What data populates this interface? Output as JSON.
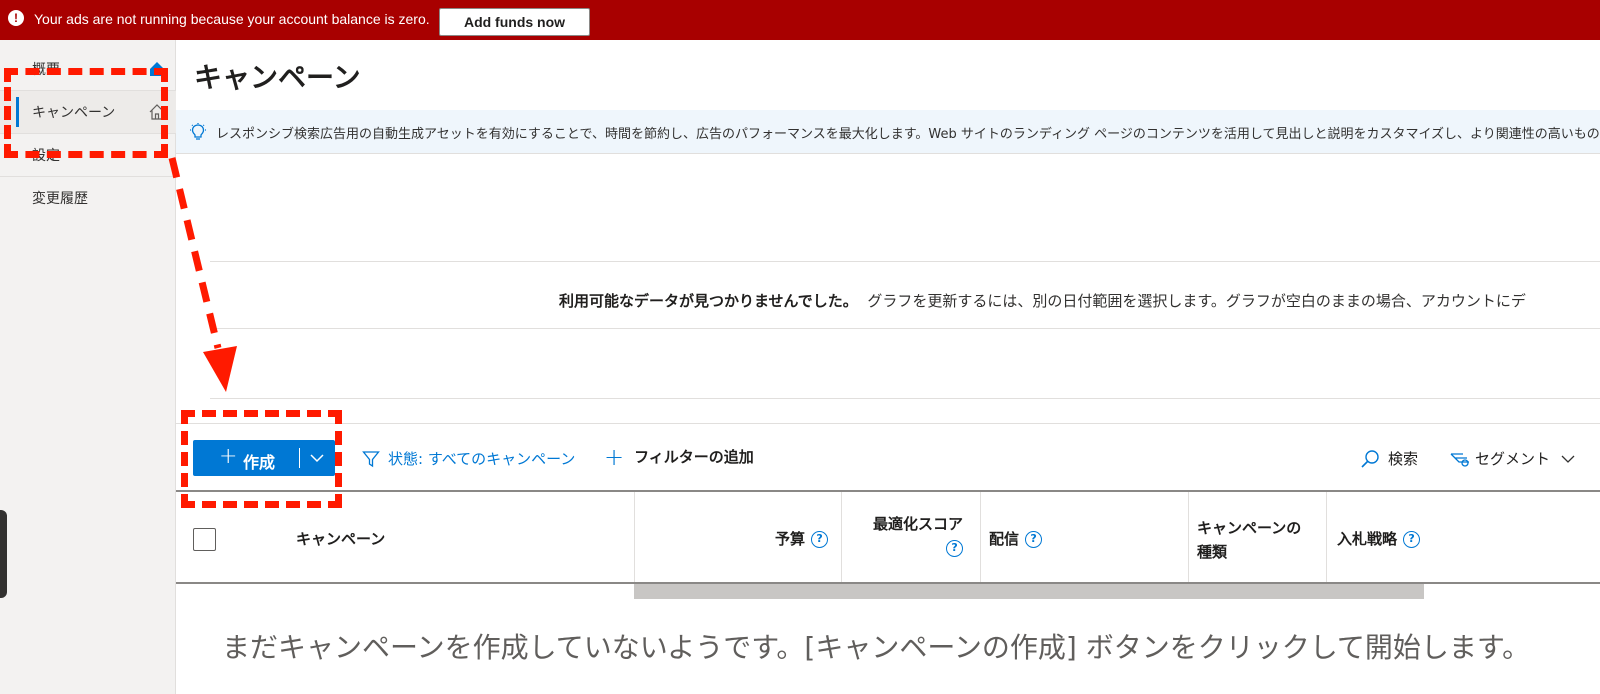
{
  "banner": {
    "message": "Your ads are not running because your account balance is zero.",
    "button_label": "Add funds now",
    "icon": "alert-icon",
    "color": "#a80000"
  },
  "sidebar": {
    "items": [
      {
        "label": "概要",
        "icon": "home-icon"
      },
      {
        "label": "キャンペーン",
        "icon": "home-icon",
        "active": true
      },
      {
        "label": "設定"
      },
      {
        "label": "変更履歴"
      }
    ]
  },
  "page": {
    "title": "キャンペーン"
  },
  "tip": {
    "icon": "lightbulb-icon",
    "text": "レスポンシブ検索広告用の自動生成アセットを有効にすることで、時間を節約し、広告のパフォーマンスを最大化します。Web サイトのランディング ページのコンテンツを活用して見出しと説明をカスタマイズし、より関連性の高いものにします"
  },
  "chart": {
    "nodata_bold": "利用可能なデータが見つかりませんでした。",
    "nodata_text": "グラフを更新するには、別の日付範囲を選択します。グラフが空白のままの場合、アカウントにデ"
  },
  "toolbar": {
    "create_label": "作成",
    "filter_status": "状態: すべてのキャンペーン",
    "add_filter": "フィルターの追加",
    "search": "検索",
    "segment": "セグメント"
  },
  "table": {
    "columns": {
      "campaign": "キャンペーン",
      "budget": "予算",
      "optimization_score_line1": "最適化スコア",
      "delivery": "配信",
      "campaign_type_line1": "キャンペーンの",
      "campaign_type_line2": "種類",
      "bid_strategy": "入札戦略"
    },
    "help_glyph": "?",
    "empty_message": "まだキャンペーンを作成していないようです。[キャンペーンの作成] ボタンをクリックして開始します。"
  },
  "colors": {
    "accent": "#0078d4",
    "annotation": "#ff1a00"
  }
}
